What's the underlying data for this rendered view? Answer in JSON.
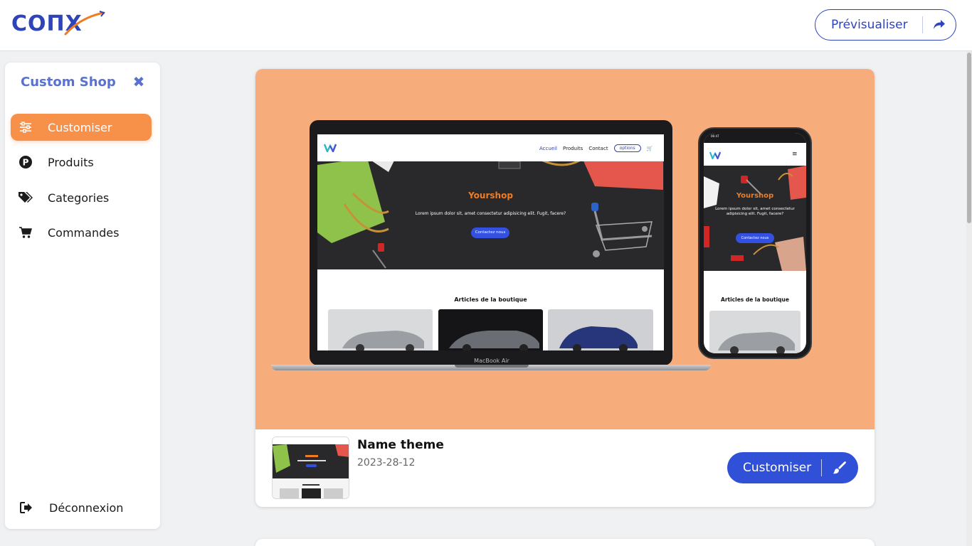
{
  "header": {
    "logo_text": "COΠX",
    "preview_label": "Prévisualiser"
  },
  "sidebar": {
    "title": "Custom Shop",
    "close_icon": "close-icon",
    "items": [
      {
        "label": "Customiser",
        "icon": "sliders-icon",
        "active": true
      },
      {
        "label": "Produits",
        "icon": "p-circle-icon",
        "active": false
      },
      {
        "label": "Categories",
        "icon": "tags-icon",
        "active": false
      },
      {
        "label": "Commandes",
        "icon": "cart-icon",
        "active": false
      }
    ],
    "logout_label": "Déconnexion"
  },
  "theme_card": {
    "mockup": {
      "laptop": {
        "nav_links": [
          "Accueil",
          "Produits",
          "Contact"
        ],
        "options_label": "options",
        "hero_title": "Yourshop",
        "hero_subtitle": "Lorem ipsum dolor sit, amet consectetur adipisicing elit. Fugit, facere?",
        "hero_button": "Contactez nous",
        "articles_title": "Articles de la boutique",
        "brand": "MacBook Air"
      },
      "phone": {
        "status_time": "06:47",
        "hero_title": "Yourshop",
        "hero_subtitle": "Lorem ipsum dolor sit, amet consectetur adipisicing elit. Fugit, facere?",
        "hero_button": "Contactez nous",
        "articles_title": "Articles de la boutique"
      }
    },
    "name": "Name theme",
    "date": "2023-28-12",
    "customise_label": "Customiser"
  },
  "colors": {
    "brand_blue": "#2f44b9",
    "accent_orange": "#f7914a",
    "hero_peach": "#f6ad7b",
    "button_blue": "#3150d8"
  }
}
